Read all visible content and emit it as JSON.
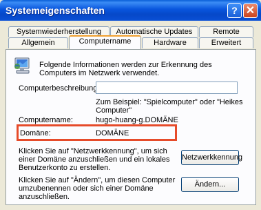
{
  "window": {
    "title": "Systemeigenschaften",
    "help_label": "?",
    "close_label": "✕"
  },
  "tabs": {
    "row1": [
      "Systemwiederherstellung",
      "Automatische Updates",
      "Remote"
    ],
    "row2": [
      "Allgemein",
      "Computername",
      "Hardware",
      "Erweitert"
    ],
    "active": "Computername"
  },
  "panel": {
    "intro_text": "Folgende Informationen werden zur Erkennung des Computers im Netzwerk verwendet.",
    "description_label": "Computerbeschreibung:",
    "description_value": "",
    "description_hint": "Zum Beispiel: \"Spielcomputer\" oder \"Heikes Computer\"",
    "computername_label": "Computername:",
    "computername_value": "hugo-huang-g.DOMÄNE",
    "domain_label": "Domäne:",
    "domain_value": "DOMÄNE",
    "network_id_text": "Klicken Sie auf \"Netzwerkkennung\", um sich einer Domäne anzuschließen und ein lokales Benutzerkonto zu erstellen.",
    "network_id_button": "Netzwerkkennung",
    "change_text": "Klicken Sie auf \"Ändern\", um diesen Computer umzubenennen oder sich einer Domäne anzuschließen.",
    "change_button": "Ändern..."
  },
  "colors": {
    "highlight": "#e64b2a",
    "titlebar": "#0855dd"
  }
}
